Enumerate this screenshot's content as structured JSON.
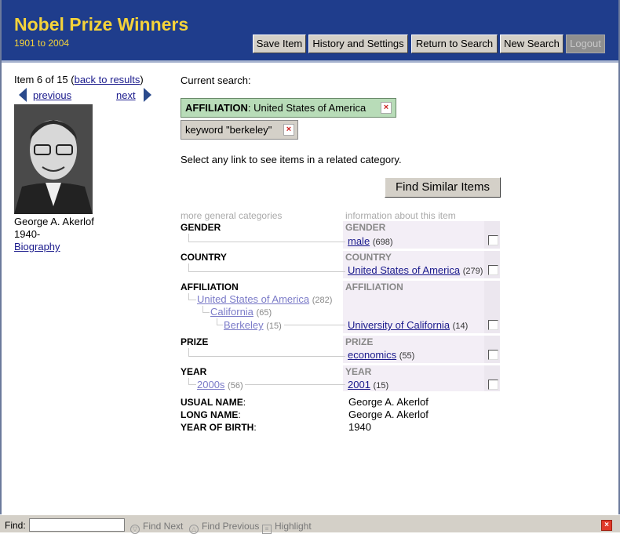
{
  "app": {
    "title": "Nobel Prize Winners",
    "subtitle": "1901 to 2004"
  },
  "header_buttons": {
    "save": "Save Item",
    "history": "History and Settings",
    "return": "Return to Search",
    "new": "New Search",
    "logout": "Logout"
  },
  "left": {
    "item_prefix": "Item 6 of 15 (",
    "back_link": "back to results",
    "item_suffix": ")",
    "previous": "previous",
    "next": "next",
    "name": "George A. Akerlof",
    "years": "1940-",
    "biography": "Biography"
  },
  "search": {
    "label": "Current search:",
    "chip1_field": "AFFILIATION",
    "chip1_value": ": United States of America",
    "chip2": "keyword \"berkeley\"",
    "remove_glyph": "×",
    "instruction": "Select any link to see items in a related category.",
    "find_similar": "Find Similar Items"
  },
  "categories": {
    "col_general": "more general categories",
    "col_info": "information about this item",
    "gender": {
      "label": "GENDER",
      "value": "male",
      "count": "(698)"
    },
    "country": {
      "label": "COUNTRY",
      "value": "United States of America",
      "count": "(279)"
    },
    "affiliation": {
      "label": "AFFILIATION",
      "l1": "United States of America",
      "l1_count": "(282)",
      "l2": "California",
      "l2_count": "(65)",
      "l3": "Berkeley",
      "l3_count": "(15)",
      "value": "University of California",
      "count": "(14)"
    },
    "prize": {
      "label": "PRIZE",
      "value": "economics",
      "count": "(55)"
    },
    "year": {
      "label": "YEAR",
      "l1": "2000s",
      "l1_count": "(56)",
      "value": "2001",
      "count": "(15)"
    }
  },
  "details": {
    "usual_label": "USUAL NAME",
    "usual_value": "George A. Akerlof",
    "long_label": "LONG NAME",
    "long_value": "George A. Akerlof",
    "birth_label": "YEAR OF BIRTH",
    "birth_value": "1940",
    "colon": ":"
  },
  "findbar": {
    "label": "Find:",
    "find_next": "Find Next",
    "find_previous": "Find Previous",
    "highlight": "Highlight",
    "close": "×"
  },
  "colors": {
    "header": "#1f3d8c",
    "title": "#f5d33a",
    "chip_affiliation": "#b8dcb8",
    "chip_keyword": "#d4d0c8",
    "category_bg": "#f3eef6"
  }
}
